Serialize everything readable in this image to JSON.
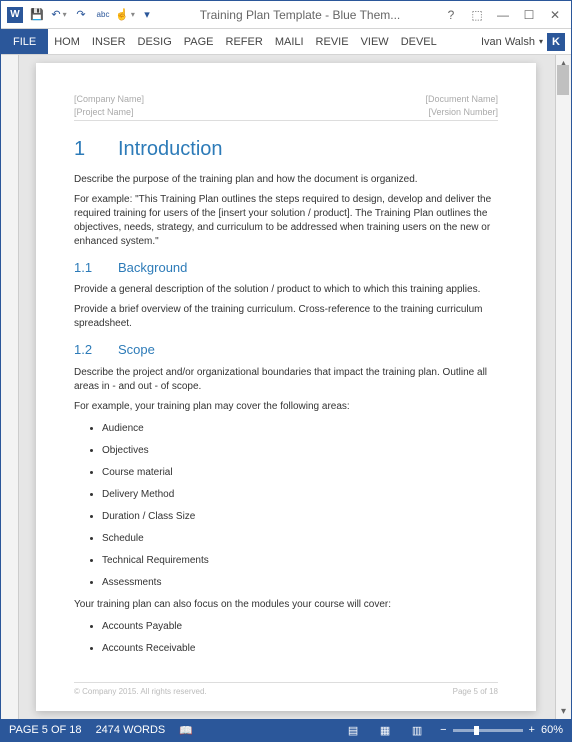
{
  "title": "Training Plan Template - Blue Them...",
  "qat": {
    "save": "💾",
    "undo": "↶",
    "redo": "↷",
    "spell": "abc",
    "touch": "☝"
  },
  "tabs": {
    "file": "FILE",
    "t": [
      "HOM",
      "INSER",
      "DESIG",
      "PAGE",
      "REFER",
      "MAILI",
      "REVIE",
      "VIEW",
      "DEVEL"
    ]
  },
  "user": {
    "name": "Ivan Walsh",
    "initial": "K"
  },
  "help": "?",
  "doc": {
    "hdr": {
      "l1": "[Company Name]",
      "l2": "[Project Name]",
      "r1": "[Document Name]",
      "r2": "[Version Number]"
    },
    "h1num": "1",
    "h1": "Introduction",
    "p1": "Describe the purpose of the training plan and how the document is organized.",
    "p2": "For example: \"This Training Plan outlines the steps required to design, develop and deliver the required training for users of the [insert your solution / product]. The Training Plan outlines the objectives, needs, strategy, and curriculum to be addressed when training users on the new or enhanced system.\"",
    "h11num": "1.1",
    "h11": "Background",
    "p3": "Provide a general description of the solution / product to which to which this training applies.",
    "p4": "Provide a brief overview of the training curriculum. Cross-reference to the training curriculum spreadsheet.",
    "h12num": "1.2",
    "h12": "Scope",
    "p5": "Describe the project and/or organizational boundaries that impact the training plan. Outline all areas in - and out - of scope.",
    "p6": "For example, your training plan may cover the following areas:",
    "list1": [
      "Audience",
      "Objectives",
      "Course material",
      "Delivery Method",
      "Duration / Class Size",
      "Schedule",
      "Technical Requirements",
      "Assessments"
    ],
    "p7": "Your training plan can also focus on the modules your course will cover:",
    "list2": [
      "Accounts Payable",
      "Accounts Receivable"
    ],
    "ftr": {
      "l": "© Company 2015. All rights reserved.",
      "r": "Page 5 of 18"
    }
  },
  "status": {
    "page": "PAGE 5 OF 18",
    "words": "2474 WORDS",
    "proof": "📖",
    "zoom": "60%",
    "minus": "−",
    "plus": "+"
  }
}
